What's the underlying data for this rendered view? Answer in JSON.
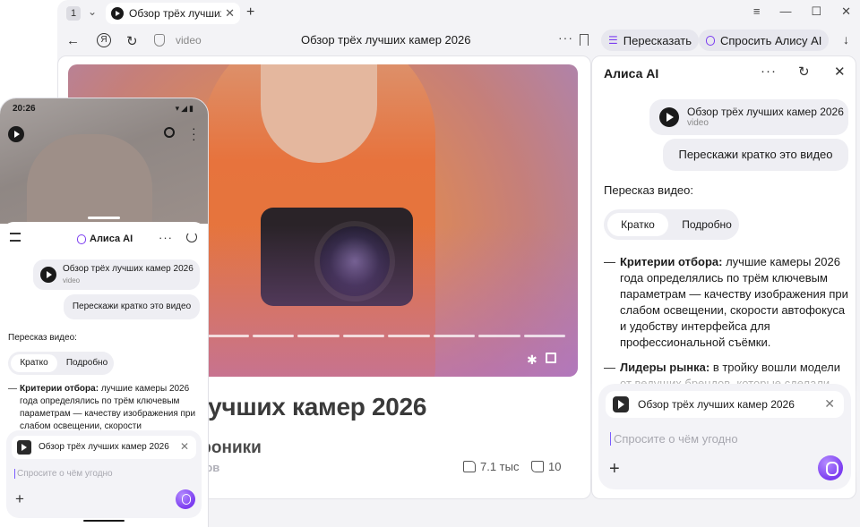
{
  "browser": {
    "tab_count": "1",
    "tab_title": "Обзор трёх лучших к",
    "url_text": "video",
    "page_title": "Обзор трёх лучших камер 2026",
    "retell_button": "Пересказать",
    "ask_alice_button": "Спросить Алису AI"
  },
  "video_page": {
    "title_fragment": "лучших камер 2026",
    "channel_fragment": "троники",
    "subs_fragment": "иков",
    "likes": "7.1 тыс",
    "dislikes": "10"
  },
  "alice": {
    "title": "Алиса AI",
    "video_card_title": "Обзор трёх лучших камер 2026",
    "video_card_sub": "video",
    "user_message": "Перескажи кратко это видео",
    "answer_head": "Пересказ видео:",
    "seg_short": "Кратко",
    "seg_detail": "Подробно",
    "bullets": [
      {
        "dash": "—",
        "bold": "Критерии отбора:",
        "text": " лучшие камеры 2026 года определялись по трём ключевым параметрам — качеству изображения при слабом освещении, скорости автофокуса и удобству интерфейса для профессиональной съёмки."
      },
      {
        "dash": "—",
        "bold": "Лидеры рынка:",
        "text": " в тройку вошли модели от ведущих брендов, которые сделали"
      }
    ],
    "composer_chip": "Обзор трёх лучших камер 2026",
    "composer_placeholder": "Спросите о чём угодно"
  },
  "phone": {
    "time": "20:26",
    "signal": "▾◢▮",
    "title": "Алиса AI",
    "video_card_title": "Обзор трёх лучших камер 2026",
    "video_card_sub": "video",
    "user_message": "Перескажи кратко это видео",
    "answer_head": "Пересказ видео:",
    "seg_short": "Кратко",
    "seg_detail": "Подробно",
    "bullet_dash": "—",
    "bullet_bold": "Критерии отбора:",
    "bullet_text": " лучшие камеры 2026 года определялись по трём ключевым параметрам — качеству изображения при слабом освещении, скорости",
    "composer_chip": "Обзор трёх лучших камер 2026",
    "composer_placeholder": "Спросите о чём угодно"
  },
  "icons": {
    "chevron": "⌄",
    "close": "✕",
    "plus": "+",
    "menu": "≡",
    "minimize": "—",
    "maximize": "☐",
    "back": "←",
    "yandex": "Я",
    "reload": "↻",
    "more": "···",
    "download": "↓",
    "retell": "☰",
    "settings": "✱",
    "refresh": "↻"
  },
  "colors": {
    "accent": "#7b3cf0",
    "bubble": "#eeeef3",
    "chrome": "#f3f3f6"
  }
}
